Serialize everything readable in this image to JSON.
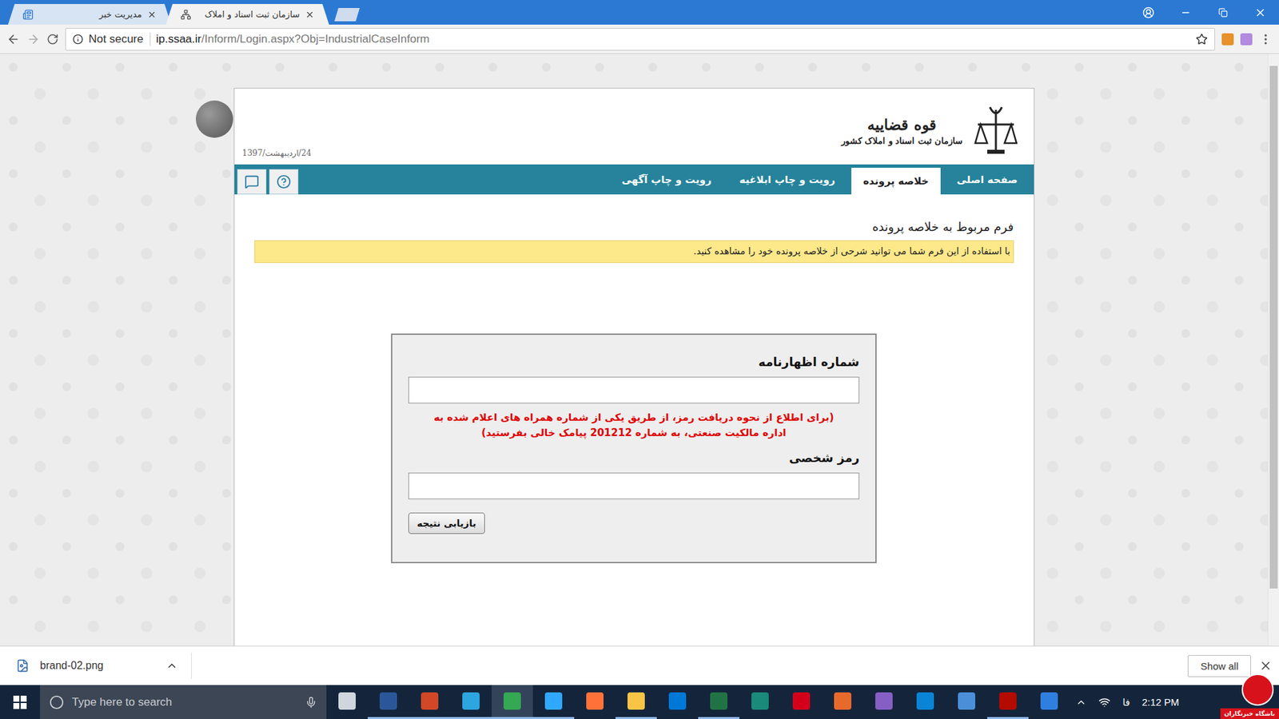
{
  "browser": {
    "tabs": [
      {
        "label": "مدیریت خبر",
        "selected": false
      },
      {
        "label": "سازمان ثبت اسناد و املاک",
        "selected": true
      }
    ],
    "address": {
      "security": "Not secure",
      "host": "ip.ssaa.ir",
      "path": "/Inform/Login.aspx?Obj=IndustrialCaseInform"
    }
  },
  "header": {
    "date": "24/اردیبهشت/1397",
    "org": "قوه قضاییه",
    "suborg": "سازمان ثبت اسناد و املاک کشور"
  },
  "nav": [
    {
      "label": "صفحه اصلی",
      "selected": false
    },
    {
      "label": "خلاصه پرونده",
      "selected": true
    },
    {
      "label": "رویت و چاپ ابلاغیه",
      "selected": false
    },
    {
      "label": "رویت و چاپ آگهی",
      "selected": false
    }
  ],
  "form": {
    "title": "فرم مربوط به خلاصه پرونده",
    "note": "با استفاده از این فرم شما می توانید شرحی از خلاصه پرونده خود را مشاهده کنید.",
    "fields": [
      {
        "label": "شماره اظهارنامه",
        "value": "",
        "hint": "(برای اطلاع از نحوه دریافت رمز، از طریق یکی از شماره همراه های اعلام شده به اداره مالکیت صنعتی، به شماره 201212 پیامک خالی بفرستید)"
      },
      {
        "label": "رمز شخصی",
        "value": "",
        "hint": ""
      }
    ],
    "button": "بازیابی نتیجه"
  },
  "downloads": {
    "file": "brand-02.png",
    "show_all": "Show all"
  },
  "taskbar": {
    "search": "Type here to search",
    "lang": "فا",
    "time": "2:12 PM",
    "watermark": "باشگاه خبرنگاران",
    "apps": [
      {
        "running": false,
        "active": false,
        "color": "#d0d6de"
      },
      {
        "running": true,
        "active": false,
        "color": "#2b579a"
      },
      {
        "running": true,
        "active": false,
        "color": "#d24726"
      },
      {
        "running": true,
        "active": false,
        "color": "#2ca5e0"
      },
      {
        "running": true,
        "active": true,
        "color": "#34a853"
      },
      {
        "running": true,
        "active": false,
        "color": "#31a8ff"
      },
      {
        "running": false,
        "active": false,
        "color": "#ff7139"
      },
      {
        "running": true,
        "active": false,
        "color": "#f8c445"
      },
      {
        "running": false,
        "active": false,
        "color": "#0078d7"
      },
      {
        "running": true,
        "active": false,
        "color": "#217346"
      },
      {
        "running": false,
        "active": false,
        "color": "#1a8a7a"
      },
      {
        "running": false,
        "active": false,
        "color": "#d4001a"
      },
      {
        "running": false,
        "active": false,
        "color": "#e8692c"
      },
      {
        "running": false,
        "active": false,
        "color": "#865fc5"
      },
      {
        "running": false,
        "active": false,
        "color": "#0a84d6"
      },
      {
        "running": false,
        "active": false,
        "color": "#4a8fd8"
      },
      {
        "running": true,
        "active": false,
        "color": "#b30b00"
      },
      {
        "running": false,
        "active": false,
        "color": "#2f7fe0"
      }
    ]
  }
}
